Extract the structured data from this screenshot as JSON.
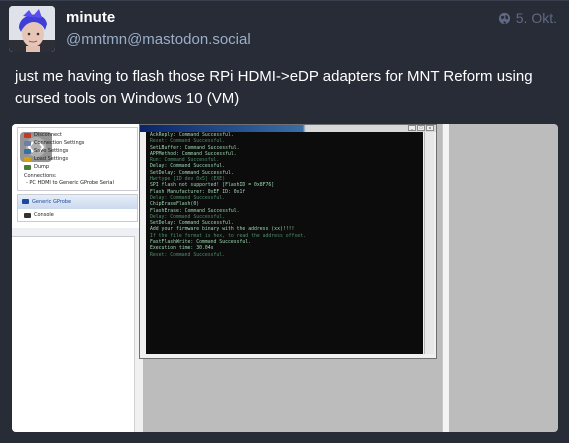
{
  "post": {
    "display_name": "minute",
    "account": "@mntmn@mastodon.social",
    "visibility_icon": "globe-icon",
    "timestamp": "5. Okt.",
    "content": "just me having to flash those RPi HDMI->eDP adapters for MNT Reform using cursed tools on Windows 10 (VM)"
  },
  "media": {
    "left_panel": {
      "items": [
        "Disconnect",
        "Connection Settings",
        "Save Settings",
        "Load Settings",
        "Dump",
        "Connections:",
        "- PC HDMI to Generic GProbe Serial"
      ],
      "probe_label": "Generic GProbe",
      "console_label": "Console"
    },
    "terminal": {
      "lines": [
        "AckReply: Command Successful.",
        "Reset: Command Successful.",
        "SetLBuffer: Command Successful.",
        "APPMethod: Command Successful.",
        "Run: Command Successful.",
        "Delay: Command Successful.",
        "SetDelay: Command Successful.",
        "Hwrtype [ID dev 0x5] (EXE)",
        "SPI flash not supported! [FlashID = 0x8F76]",
        "Flash Manufacturer: 0xEF ID: 0x1f",
        "Delay: Command Successful.",
        "ChipEraseFlash(0)",
        "FlashErase: Command Successful.",
        "Delay: Command Successful.",
        "SetDelay: Command Successful.",
        "Add your firmware binary with the address (xx)!!!!",
        "If the file format is hex, to read the address offset.",
        "FastFlashWrite: Command Successful.",
        "Execution time: 30.04s",
        "Reset: Command Successful."
      ]
    }
  }
}
